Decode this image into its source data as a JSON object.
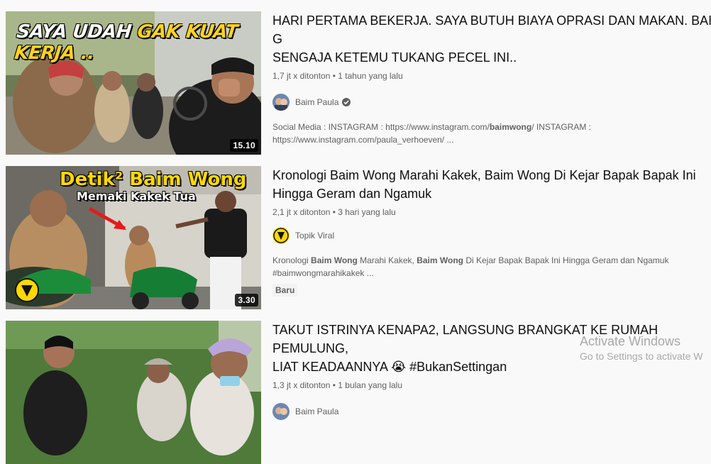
{
  "videos": [
    {
      "thumb_caption_white": "SAYA UDAH ",
      "thumb_caption_yellow": "GAK KUAT KERJA ..",
      "duration": "15.10",
      "title": "HARI PERTAMA BEKERJA. SAYA BUTUH BIAYA OPRASI DAN MAKAN. BAIM G\nSENGAJA KETEMU TUKANG PECEL INI..",
      "views": "1,7 jt x ditonton",
      "sep": "•",
      "age": "1 tahun yang lalu",
      "channel": "Baim Paula",
      "desc_a": "Social Media : INSTAGRAM : https://www.instagram.com/",
      "desc_b": "baimwong",
      "desc_c": "/ INSTAGRAM :",
      "desc_d": "https://www.instagram.com/paula_verhoeven/ ..."
    },
    {
      "thumb_caption_1": "Detik² Baim Wong",
      "thumb_caption_2": "Memaki Kakek Tua",
      "duration": "3.30",
      "title": "Kronologi Baim Wong Marahi Kakek, Baim Wong Di Kejar Bapak Bapak Ini\nHingga Geram dan Ngamuk",
      "views": "2,1 jt x ditonton",
      "sep": "•",
      "age": "3 hari yang lalu",
      "channel": "Topik Viral",
      "desc_a": "Kronologi ",
      "desc_b": "Baim Wong",
      "desc_c": " Marahi Kakek, ",
      "desc_d": "Baim Wong",
      "desc_e": " Di Kejar Bapak Bapak Ini Hingga Geram dan Ngamuk",
      "desc_f": "#baimwongmarahikakek ...",
      "badge": "Baru"
    },
    {
      "title": "TAKUT ISTRINYA KENAPA2, LANGSUNG BRANGKAT KE RUMAH PEMULUNG,\nLIAT KEADAANNYA 😭 #BukanSettingan",
      "views": "1,3 jt x ditonton",
      "sep": "•",
      "age": "1 bulan yang lalu",
      "channel": "Baim Paula"
    }
  ],
  "watermark": {
    "title": "Activate Windows",
    "subtitle": "Go to Settings to activate W"
  },
  "colors": {
    "background": "#f9f9f9",
    "title": "#0f0f0f",
    "meta": "#606060",
    "thumb_caption_yellow": "#ffd21f"
  },
  "icons": [
    "verified-check-icon",
    "topik-viral-logo-icon",
    "red-arrow-icon"
  ]
}
